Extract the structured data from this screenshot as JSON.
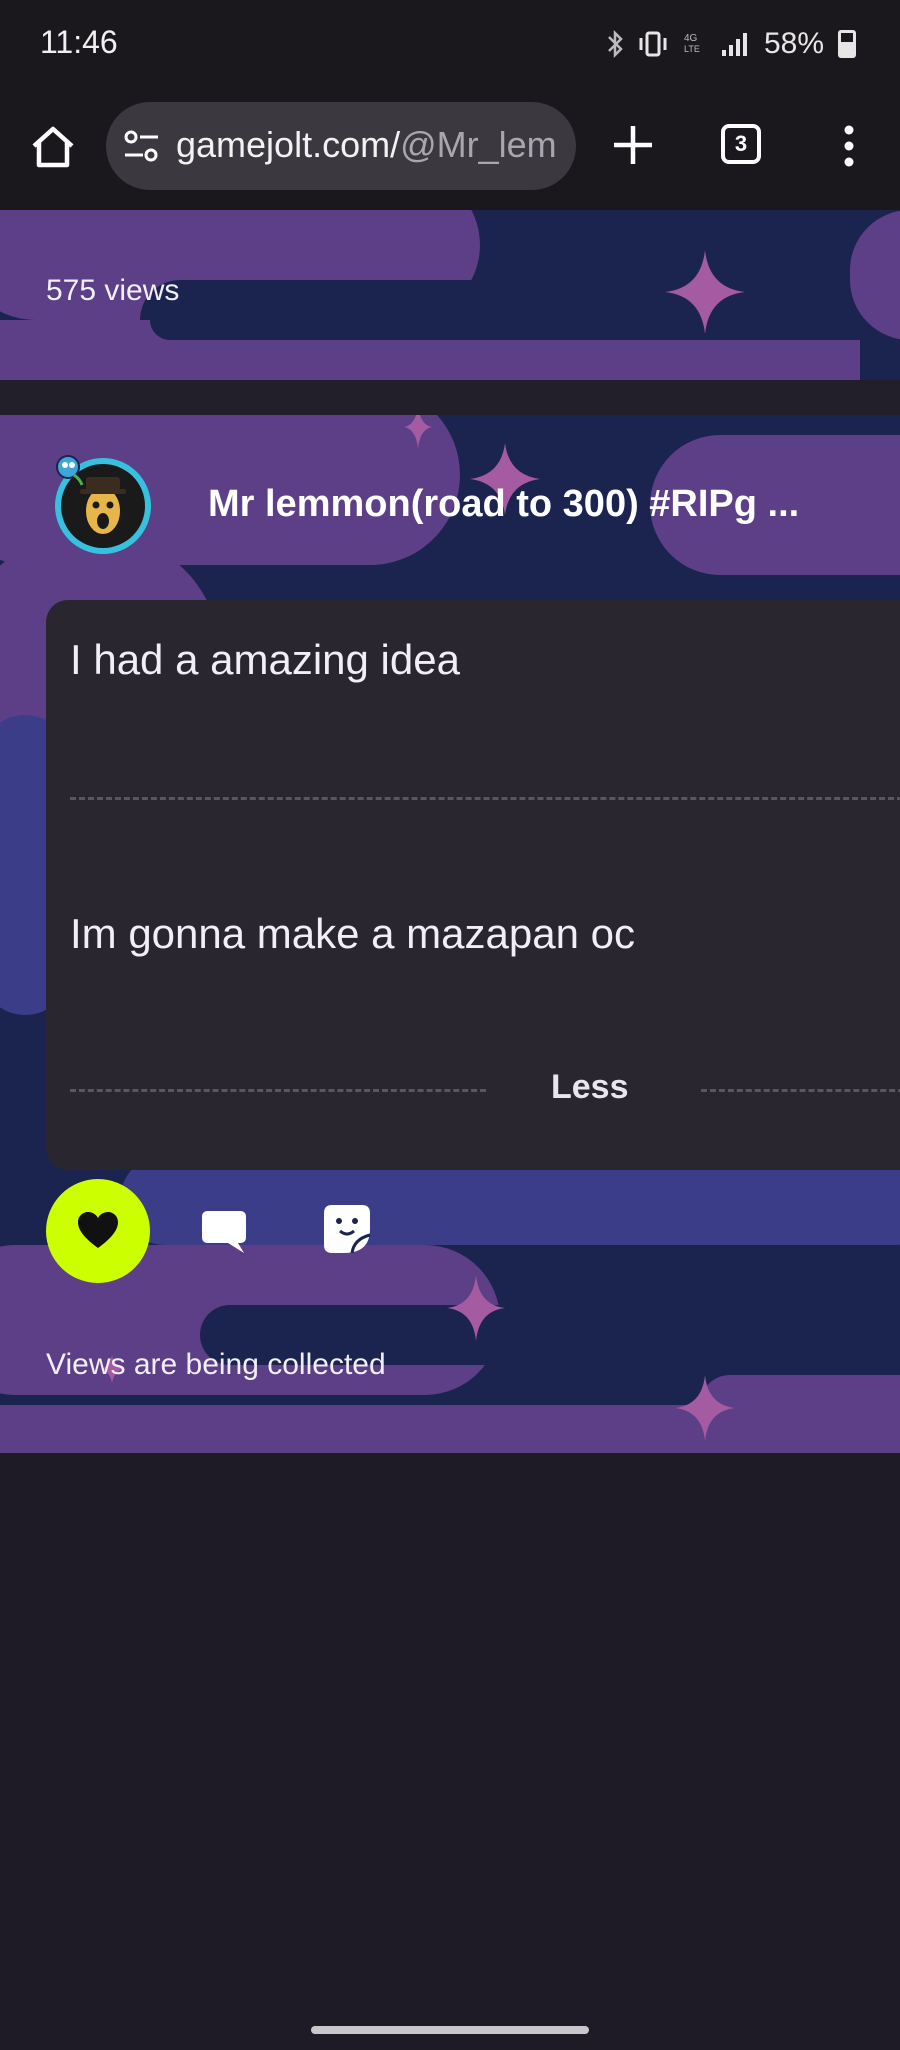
{
  "status_bar": {
    "time": "11:46",
    "battery": "58%",
    "icons": [
      "bluetooth-icon",
      "vibrate-icon",
      "4g-lte-icon",
      "signal-icon",
      "battery-icon"
    ]
  },
  "browser": {
    "url_host": "gamejolt.com/",
    "url_path": "@Mr_lem",
    "tab_count": "3",
    "icons": [
      "home-icon",
      "site-settings-icon",
      "plus-icon",
      "tabs-icon",
      "more-vert-icon"
    ]
  },
  "feed": {
    "previous_post": {
      "views": "575 views"
    },
    "post": {
      "author": "Mr lemmon(road to 300) #RIPg ...",
      "paragraphs": [
        "I had a amazing idea",
        "Im gonna make a mazapan oc"
      ],
      "less_label": "Less",
      "views": "Views are being collected"
    }
  },
  "colors": {
    "like_accent": "#ccff00",
    "card_bg": "#2a2630",
    "galaxy_dark": "#1b234f",
    "galaxy_purple": "#5c3f86"
  }
}
